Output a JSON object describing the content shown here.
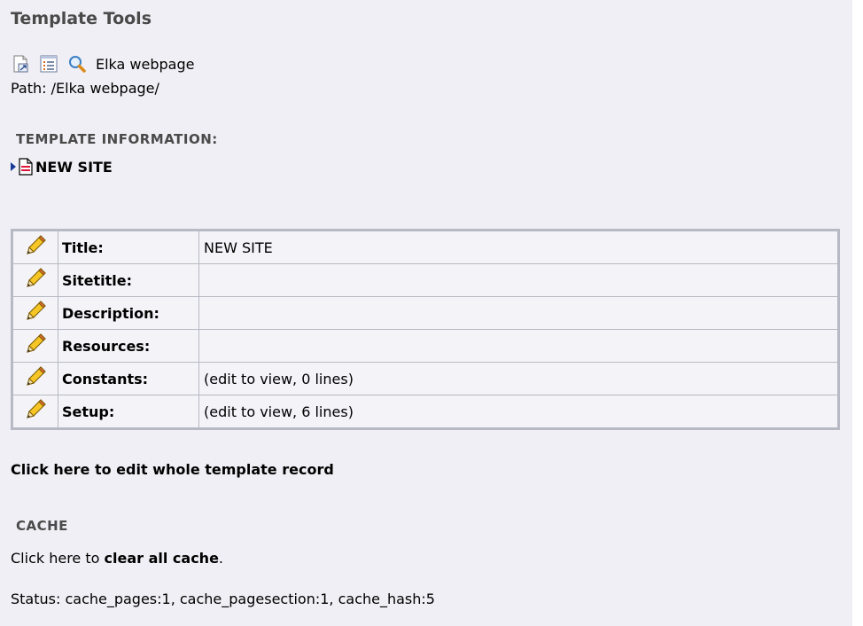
{
  "header": {
    "title": "Template Tools"
  },
  "toolbar": {
    "icons": [
      "view-page-icon",
      "list-view-icon",
      "search-icon"
    ],
    "page_name": "Elka webpage"
  },
  "path": {
    "text": "Path: /Elka webpage/"
  },
  "template_info": {
    "heading": "TEMPLATE INFORMATION:",
    "record_name": "NEW SITE"
  },
  "properties": [
    {
      "label": "Title:",
      "value": "NEW SITE"
    },
    {
      "label": "Sitetitle:",
      "value": ""
    },
    {
      "label": "Description:",
      "value": ""
    },
    {
      "label": "Resources:",
      "value": ""
    },
    {
      "label": "Constants:",
      "value": "(edit to view, 0 lines)"
    },
    {
      "label": "Setup:",
      "value": "(edit to view, 6 lines)"
    }
  ],
  "edit_record_link": "Click here to edit whole template record",
  "cache": {
    "heading": "CACHE",
    "prefix": "Click here to ",
    "clear_link": "clear all cache",
    "suffix": ".",
    "status": "Status: cache_pages:1, cache_pagesection:1, cache_hash:5"
  },
  "colors": {
    "background": "#f0eff5",
    "table_border": "#b7bac4",
    "heading_gray": "#4a4a4a"
  }
}
